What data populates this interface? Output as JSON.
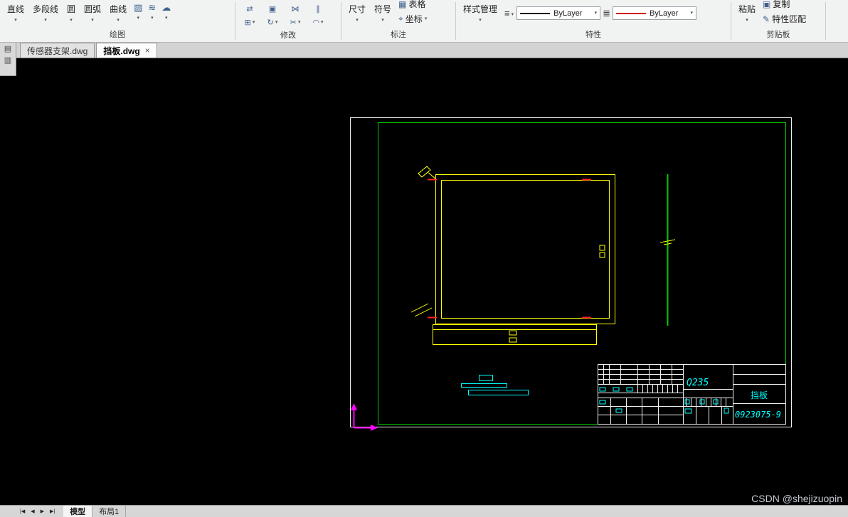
{
  "app": {
    "watermark": "CSDN @shejizuopin"
  },
  "colors": {
    "sheet_border": "#f0f0f0",
    "frame_green": "#00cc00",
    "entity_yellow": "#ffff00",
    "mark_red": "#ff2020",
    "anno_cyan": "#00ffff",
    "ucs_magenta": "#ff00ff"
  },
  "icons": {
    "caret": "▾",
    "close": "×",
    "hatch": "▨",
    "multiline": "≋",
    "revcloud": "☁",
    "table": "▦",
    "coordinate": "⌖",
    "style_list": "≡",
    "lineweight": "≣",
    "copy": "▣",
    "match_brush": "✎",
    "side_top": "▤",
    "side_bottom": "▥",
    "modify": [
      "⇄",
      "▣",
      "⋈",
      "∥",
      "⊞",
      "↻",
      "✂",
      "◠"
    ]
  },
  "ribbon": {
    "draw": {
      "label": "绘图",
      "line": "直线",
      "polyline": "多段线",
      "circle": "圆",
      "arc": "圆弧",
      "spline": "曲线"
    },
    "modify": {
      "label": "修改"
    },
    "annotate": {
      "label": "标注",
      "dimension": "尺寸",
      "symbol": "符号",
      "table": "表格",
      "coordinate": "坐标"
    },
    "properties": {
      "label": "特性",
      "style_manager": "样式管理",
      "color_value": "ByLayer",
      "linetype_value": "ByLayer"
    },
    "clipboard": {
      "label": "剪贴板",
      "paste": "粘贴",
      "copy": "复制",
      "match_properties": "特性匹配"
    }
  },
  "document_tabs": [
    {
      "label": "传感器支架.dwg"
    },
    {
      "label": "挡板.dwg"
    }
  ],
  "drawing": {
    "material": "Q235",
    "part_name": "挡板",
    "part_number": "0923075-9"
  },
  "statusbar": {
    "nav_first": "|◀",
    "nav_prev": "◀",
    "nav_next": "▶",
    "nav_last": "▶|",
    "model_tab": "模型",
    "layout_tab": "布局1"
  }
}
